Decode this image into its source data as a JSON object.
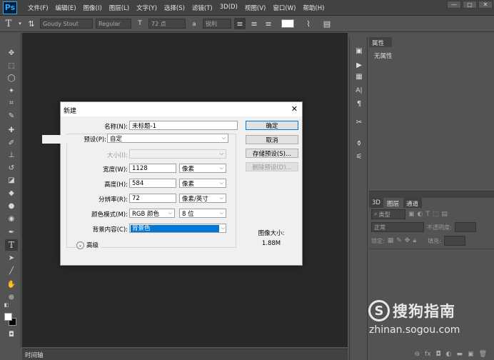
{
  "app": {
    "logo": "Ps"
  },
  "menu": [
    "文件(F)",
    "编辑(E)",
    "图像(I)",
    "图层(L)",
    "文字(Y)",
    "选择(S)",
    "滤镜(T)",
    "3D(D)",
    "视图(V)",
    "窗口(W)",
    "帮助(H)"
  ],
  "window_controls": [
    "—",
    "▢",
    "✕"
  ],
  "options": {
    "font_family": "Goudy Stout",
    "font_style": "Regular",
    "font_size": "72 点",
    "antialias": "锐利"
  },
  "timeline": {
    "label": "时间轴"
  },
  "properties": {
    "tab": "属性",
    "empty": "无属性"
  },
  "layers_panel": {
    "tabs": [
      "3D",
      "图层",
      "通道"
    ],
    "filter": "类型",
    "blend": "正常",
    "opacity_label": "不透明度:",
    "lock_label": "锁定:",
    "fill_label": "填充:"
  },
  "dialog": {
    "title": "新建",
    "name_label": "名称(N):",
    "name_value": "未标题-1",
    "preset_label": "预设(P):",
    "preset_value": "自定",
    "size_label": "大小(I):",
    "width_label": "宽度(W):",
    "width_value": "1128",
    "width_unit": "像素",
    "height_label": "高度(H):",
    "height_value": "584",
    "height_unit": "像素",
    "resolution_label": "分辨率(R):",
    "resolution_value": "72",
    "resolution_unit": "像素/英寸",
    "color_mode_label": "颜色模式(M):",
    "color_mode_value": "RGB 颜色",
    "bit_depth": "8 位",
    "background_label": "背景内容(C):",
    "background_value": "背景色",
    "advanced_label": "高级",
    "ok_button": "确定",
    "cancel_button": "取消",
    "save_preset_button": "存储预设(S)...",
    "delete_preset_button": "删除预设(D)...",
    "image_size_label": "图像大小:",
    "image_size_value": "1.88M"
  },
  "watermark": {
    "text1": "搜狗指南",
    "text2": "zhinan.sogou.com"
  }
}
